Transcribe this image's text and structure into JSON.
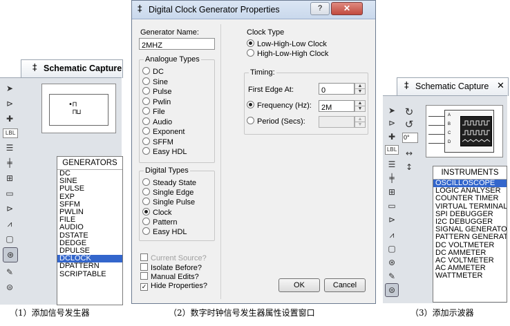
{
  "panel1": {
    "title": "Schematic Capture",
    "list_header": "GENERATORS",
    "items": [
      "DC",
      "SINE",
      "PULSE",
      "EXP",
      "SFFM",
      "PWLIN",
      "FILE",
      "AUDIO",
      "DSTATE",
      "DEDGE",
      "DPULSE",
      "DCLOCK",
      "DPATTERN",
      "SCRIPTABLE"
    ],
    "selected": "DCLOCK",
    "toolbar_label": "LBL"
  },
  "dialog": {
    "title": "Digital Clock Generator Properties",
    "help_label": "?",
    "close_label": "✕",
    "generator_name_label": "Generator Name:",
    "generator_name_value": "2MHZ",
    "analogue_title": "Analogue Types",
    "analogue_types": [
      "DC",
      "Sine",
      "Pulse",
      "Pwlin",
      "File",
      "Audio",
      "Exponent",
      "SFFM",
      "Easy HDL"
    ],
    "digital_title": "Digital Types",
    "digital_types": [
      "Steady State",
      "Single Edge",
      "Single Pulse",
      "Clock",
      "Pattern",
      "Easy HDL"
    ],
    "digital_selected": "Clock",
    "checkboxes": [
      {
        "label": "Current Source?",
        "checked": false,
        "disabled": true
      },
      {
        "label": "Isolate Before?",
        "checked": false,
        "disabled": false
      },
      {
        "label": "Manual Edits?",
        "checked": false,
        "disabled": false
      },
      {
        "label": "Hide Properties?",
        "checked": true,
        "disabled": false
      }
    ],
    "clock_type_title": "Clock Type",
    "clock_types": [
      "Low-High-Low Clock",
      "High-Low-High Clock"
    ],
    "clock_type_selected": "Low-High-Low Clock",
    "timing_title": "Timing:",
    "first_edge_label": "First Edge At:",
    "first_edge_value": "0",
    "frequency_label": "Frequency (Hz):",
    "frequency_value": "2M",
    "period_label": "Period (Secs):",
    "period_value": "",
    "ok_label": "OK",
    "cancel_label": "Cancel"
  },
  "panel3": {
    "title": "Schematic Capture",
    "close_label": "✕",
    "list_header": "INSTRUMENTS",
    "items": [
      "OSCILLOSCOPE",
      "LOGIC ANALYSER",
      "COUNTER TIMER",
      "VIRTUAL TERMINAL",
      "SPI DEBUGGER",
      "I2C DEBUGGER",
      "SIGNAL GENERATOR",
      "PATTERN GENERATOR",
      "DC VOLTMETER",
      "DC AMMETER",
      "AC VOLTMETER",
      "AC AMMETER",
      "WATTMETER"
    ],
    "selected": "OSCILLOSCOPE",
    "rotation_value": "0°",
    "toolbar_label": "LBL",
    "scope_channels": [
      "A",
      "B",
      "C",
      "D"
    ]
  },
  "captions": {
    "c1": "（1）添加信号发生器",
    "c2": "（2）数字时钟信号发生器属性设置窗口",
    "c3": "（3）添加示波器"
  },
  "colors": {
    "selection": "#3366cc",
    "dialog_bg": "#f0f0f0",
    "close_button": "#c75050",
    "panel_bg": "#dfe3e8"
  }
}
